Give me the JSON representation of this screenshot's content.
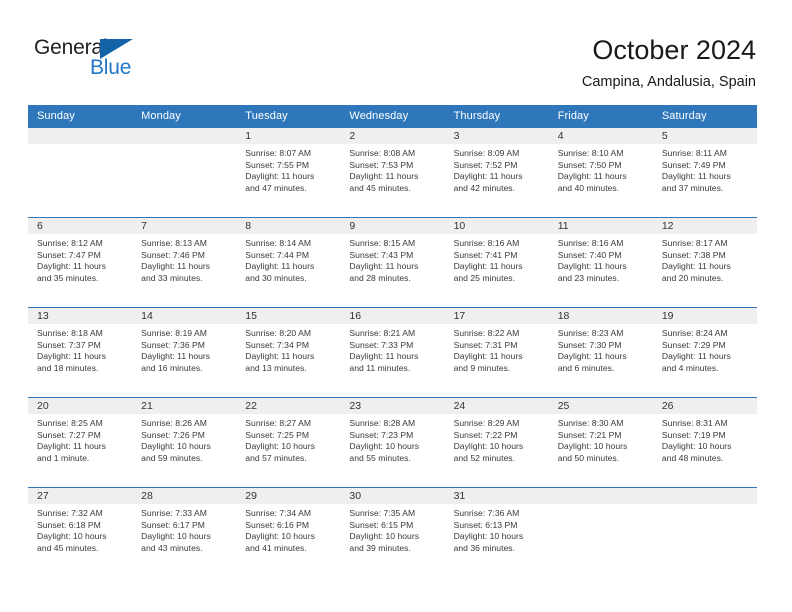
{
  "brand": {
    "name_top": "General",
    "name_bottom": "Blue",
    "accent_color": "#2277c8",
    "triangle_color": "#1363a8",
    "top_text_color": "#231f20"
  },
  "header": {
    "title": "October 2024",
    "subtitle": "Campina, Andalusia, Spain"
  },
  "theme": {
    "header_row_bg": "#2e77bb",
    "header_row_text": "#ffffff",
    "week_divider": "#2e77bb",
    "daynum_band_bg": "#efefef",
    "cell_bg": "#ffffff",
    "body_text": "#3a3a3a"
  },
  "calendar": {
    "weekday_headers": [
      "Sunday",
      "Monday",
      "Tuesday",
      "Wednesday",
      "Thursday",
      "Friday",
      "Saturday"
    ],
    "weeks": [
      [
        {
          "day": "",
          "lines": []
        },
        {
          "day": "",
          "lines": []
        },
        {
          "day": "1",
          "lines": [
            "Sunrise: 8:07 AM",
            "Sunset: 7:55 PM",
            "Daylight: 11 hours",
            "and 47 minutes."
          ]
        },
        {
          "day": "2",
          "lines": [
            "Sunrise: 8:08 AM",
            "Sunset: 7:53 PM",
            "Daylight: 11 hours",
            "and 45 minutes."
          ]
        },
        {
          "day": "3",
          "lines": [
            "Sunrise: 8:09 AM",
            "Sunset: 7:52 PM",
            "Daylight: 11 hours",
            "and 42 minutes."
          ]
        },
        {
          "day": "4",
          "lines": [
            "Sunrise: 8:10 AM",
            "Sunset: 7:50 PM",
            "Daylight: 11 hours",
            "and 40 minutes."
          ]
        },
        {
          "day": "5",
          "lines": [
            "Sunrise: 8:11 AM",
            "Sunset: 7:49 PM",
            "Daylight: 11 hours",
            "and 37 minutes."
          ]
        }
      ],
      [
        {
          "day": "6",
          "lines": [
            "Sunrise: 8:12 AM",
            "Sunset: 7:47 PM",
            "Daylight: 11 hours",
            "and 35 minutes."
          ]
        },
        {
          "day": "7",
          "lines": [
            "Sunrise: 8:13 AM",
            "Sunset: 7:46 PM",
            "Daylight: 11 hours",
            "and 33 minutes."
          ]
        },
        {
          "day": "8",
          "lines": [
            "Sunrise: 8:14 AM",
            "Sunset: 7:44 PM",
            "Daylight: 11 hours",
            "and 30 minutes."
          ]
        },
        {
          "day": "9",
          "lines": [
            "Sunrise: 8:15 AM",
            "Sunset: 7:43 PM",
            "Daylight: 11 hours",
            "and 28 minutes."
          ]
        },
        {
          "day": "10",
          "lines": [
            "Sunrise: 8:16 AM",
            "Sunset: 7:41 PM",
            "Daylight: 11 hours",
            "and 25 minutes."
          ]
        },
        {
          "day": "11",
          "lines": [
            "Sunrise: 8:16 AM",
            "Sunset: 7:40 PM",
            "Daylight: 11 hours",
            "and 23 minutes."
          ]
        },
        {
          "day": "12",
          "lines": [
            "Sunrise: 8:17 AM",
            "Sunset: 7:38 PM",
            "Daylight: 11 hours",
            "and 20 minutes."
          ]
        }
      ],
      [
        {
          "day": "13",
          "lines": [
            "Sunrise: 8:18 AM",
            "Sunset: 7:37 PM",
            "Daylight: 11 hours",
            "and 18 minutes."
          ]
        },
        {
          "day": "14",
          "lines": [
            "Sunrise: 8:19 AM",
            "Sunset: 7:36 PM",
            "Daylight: 11 hours",
            "and 16 minutes."
          ]
        },
        {
          "day": "15",
          "lines": [
            "Sunrise: 8:20 AM",
            "Sunset: 7:34 PM",
            "Daylight: 11 hours",
            "and 13 minutes."
          ]
        },
        {
          "day": "16",
          "lines": [
            "Sunrise: 8:21 AM",
            "Sunset: 7:33 PM",
            "Daylight: 11 hours",
            "and 11 minutes."
          ]
        },
        {
          "day": "17",
          "lines": [
            "Sunrise: 8:22 AM",
            "Sunset: 7:31 PM",
            "Daylight: 11 hours",
            "and 9 minutes."
          ]
        },
        {
          "day": "18",
          "lines": [
            "Sunrise: 8:23 AM",
            "Sunset: 7:30 PM",
            "Daylight: 11 hours",
            "and 6 minutes."
          ]
        },
        {
          "day": "19",
          "lines": [
            "Sunrise: 8:24 AM",
            "Sunset: 7:29 PM",
            "Daylight: 11 hours",
            "and 4 minutes."
          ]
        }
      ],
      [
        {
          "day": "20",
          "lines": [
            "Sunrise: 8:25 AM",
            "Sunset: 7:27 PM",
            "Daylight: 11 hours",
            "and 1 minute."
          ]
        },
        {
          "day": "21",
          "lines": [
            "Sunrise: 8:26 AM",
            "Sunset: 7:26 PM",
            "Daylight: 10 hours",
            "and 59 minutes."
          ]
        },
        {
          "day": "22",
          "lines": [
            "Sunrise: 8:27 AM",
            "Sunset: 7:25 PM",
            "Daylight: 10 hours",
            "and 57 minutes."
          ]
        },
        {
          "day": "23",
          "lines": [
            "Sunrise: 8:28 AM",
            "Sunset: 7:23 PM",
            "Daylight: 10 hours",
            "and 55 minutes."
          ]
        },
        {
          "day": "24",
          "lines": [
            "Sunrise: 8:29 AM",
            "Sunset: 7:22 PM",
            "Daylight: 10 hours",
            "and 52 minutes."
          ]
        },
        {
          "day": "25",
          "lines": [
            "Sunrise: 8:30 AM",
            "Sunset: 7:21 PM",
            "Daylight: 10 hours",
            "and 50 minutes."
          ]
        },
        {
          "day": "26",
          "lines": [
            "Sunrise: 8:31 AM",
            "Sunset: 7:19 PM",
            "Daylight: 10 hours",
            "and 48 minutes."
          ]
        }
      ],
      [
        {
          "day": "27",
          "lines": [
            "Sunrise: 7:32 AM",
            "Sunset: 6:18 PM",
            "Daylight: 10 hours",
            "and 45 minutes."
          ]
        },
        {
          "day": "28",
          "lines": [
            "Sunrise: 7:33 AM",
            "Sunset: 6:17 PM",
            "Daylight: 10 hours",
            "and 43 minutes."
          ]
        },
        {
          "day": "29",
          "lines": [
            "Sunrise: 7:34 AM",
            "Sunset: 6:16 PM",
            "Daylight: 10 hours",
            "and 41 minutes."
          ]
        },
        {
          "day": "30",
          "lines": [
            "Sunrise: 7:35 AM",
            "Sunset: 6:15 PM",
            "Daylight: 10 hours",
            "and 39 minutes."
          ]
        },
        {
          "day": "31",
          "lines": [
            "Sunrise: 7:36 AM",
            "Sunset: 6:13 PM",
            "Daylight: 10 hours",
            "and 36 minutes."
          ]
        },
        {
          "day": "",
          "lines": []
        },
        {
          "day": "",
          "lines": []
        }
      ]
    ]
  }
}
